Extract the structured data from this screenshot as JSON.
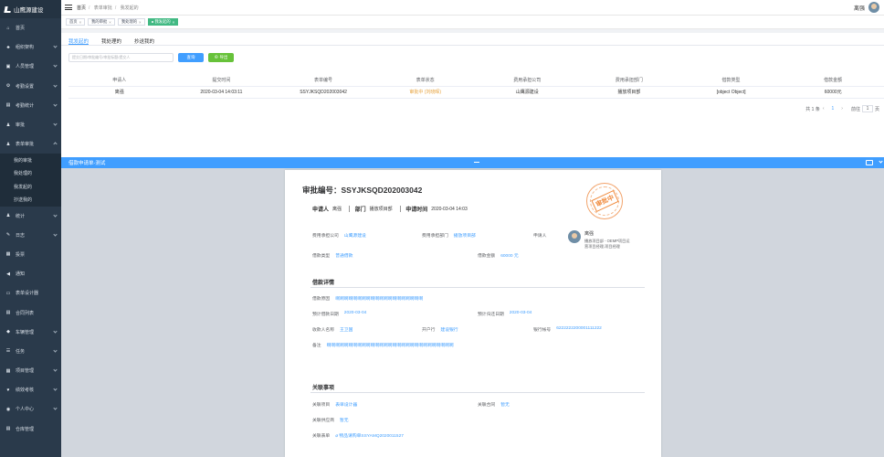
{
  "app": {
    "title": "山鹰源建设"
  },
  "sidebar": {
    "items": [
      {
        "label": "首页",
        "icon": "home-icon",
        "glyph": "⌂",
        "expanded": null
      },
      {
        "label": "组织架构",
        "icon": "org-icon",
        "glyph": "♣",
        "expanded": false
      },
      {
        "label": "人员管理",
        "icon": "people-icon",
        "glyph": "▣",
        "expanded": false
      },
      {
        "label": "考勤设置",
        "icon": "settings-icon",
        "glyph": "⚙",
        "expanded": false
      },
      {
        "label": "考勤统计",
        "icon": "calendar-icon",
        "glyph": "▤",
        "expanded": false
      },
      {
        "label": "审批",
        "icon": "user-icon",
        "glyph": "♟",
        "expanded": false
      },
      {
        "label": "表单审批",
        "icon": "user-icon",
        "glyph": "♟",
        "expanded": true
      }
    ],
    "subitems": [
      "我的审批",
      "我处理的",
      "我发起的",
      "抄送我的"
    ],
    "items_after": [
      {
        "label": "统计",
        "icon": "user-icon",
        "glyph": "♟",
        "expanded": false
      },
      {
        "label": "日志",
        "icon": "pen-icon",
        "glyph": "✎",
        "expanded": false
      },
      {
        "label": "投票",
        "icon": "briefcase-icon",
        "glyph": "▦",
        "expanded": null
      },
      {
        "label": "通知",
        "icon": "megaphone-icon",
        "glyph": "◀",
        "expanded": null
      },
      {
        "label": "表单设计器",
        "icon": "form-icon",
        "glyph": "▭",
        "expanded": null
      },
      {
        "label": "合同列表",
        "icon": "doc-icon",
        "glyph": "▤",
        "expanded": null
      },
      {
        "label": "车辆管理",
        "icon": "car-icon",
        "glyph": "◆",
        "expanded": false
      },
      {
        "label": "任务",
        "icon": "list-icon",
        "glyph": "☰",
        "expanded": false
      },
      {
        "label": "项目管理",
        "icon": "grid-icon",
        "glyph": "▦",
        "expanded": false
      },
      {
        "label": "绩效考核",
        "icon": "heart-icon",
        "glyph": "♥",
        "expanded": false
      },
      {
        "label": "个人中心",
        "icon": "person-icon",
        "glyph": "◉",
        "expanded": false
      },
      {
        "label": "仓库管理",
        "icon": "warehouse-icon",
        "glyph": "▤",
        "expanded": null
      }
    ]
  },
  "topbar": {
    "breadcrumb": [
      "首页",
      "表单审批",
      "我发起的"
    ],
    "username": "离强"
  },
  "tags": [
    {
      "label": "首页",
      "active": false
    },
    {
      "label": "我的审批",
      "active": false
    },
    {
      "label": "我处理的",
      "active": false
    },
    {
      "label": "我发起的",
      "active": true
    }
  ],
  "main": {
    "tabs": [
      "我发起的",
      "我处理的",
      "抄送我的"
    ],
    "search_placeholder": "提交日期/审批编号/审批标题/提交人",
    "search_button": "查询",
    "export_button": "⊕ 导出",
    "columns": [
      "申请人",
      "提交时间",
      "表单编号",
      "表单状态",
      "费用承担公司",
      "费用承担部门",
      "借款类型",
      "借款金额"
    ],
    "rows": [
      [
        "离强",
        "2020-03-04 14:03:11",
        "SSYJKSQD202003042",
        "审批中 (刘晓晖)",
        "山鹰源建设",
        "播放项目部",
        "[object Object]",
        "60000元"
      ]
    ],
    "pager": {
      "total": "共 1 条",
      "page": "1",
      "goto_label": "前往",
      "goto_value": "1",
      "page_unit": "页"
    }
  },
  "dialog": {
    "title": "借款申请单-测试",
    "approval_no": "审批编号：SSYJKSQD202003042",
    "applicant_label": "申请人",
    "applicant": "离强",
    "dept_label": "部门",
    "dept": "播放项目部",
    "time_label": "申请时间",
    "time": "2020-03-04 14:03",
    "stamp": "审批中",
    "fields": {
      "company_label": "费用承担公司",
      "company": "山鹰源建设",
      "cost_dept_label": "费用承担部门",
      "cost_dept": "播放项目部",
      "applicant_label": "申请人",
      "loan_type_label": "借款类型",
      "loan_type": "普通借款",
      "amount_label": "借款金额",
      "amount": "60000 元"
    },
    "applicant_card": {
      "name": "离强",
      "desc": "播放项目部 - OEMP项目运营项目经理,项目经理"
    },
    "detail_title": "借款详情",
    "detail": {
      "reason_label": "借款原因",
      "reason": "啊啊啊啊啊啊啊啊啊啊啊啊啊啊啊啊啊啊啊啊",
      "date_label": "预计借款日期",
      "date": "2020-03-04",
      "return_label": "预计归还日期",
      "return": "2020-03-04",
      "payee_label": "收款人名称",
      "payee": "王卫国",
      "bank_label": "开户行",
      "bank": "建设银行",
      "account_label": "银行帐号",
      "account": "6222222200001111222",
      "remark_label": "备注",
      "remark": "啊啊啊啊啊啊啊啊啊啊啊啊啊啊啊啊啊啊啊啊啊啊啊啊啊啊啊啊啊"
    },
    "related_title": "关联事项",
    "related": {
      "project_label": "关联项目",
      "project": "表单设计器",
      "contract_label": "关联合同",
      "contract": "暂无",
      "supplier_label": "关联供应商",
      "supplier": "暂无",
      "form_label": "关联表单",
      "form": "⌀ 物品请购单SSYAMQ2020011527"
    }
  },
  "colors": {
    "sidebar": "#2a3a4b",
    "primary": "#409eff",
    "success": "#67c23a",
    "tag_active": "#42b983",
    "warning": "#e6a23c"
  }
}
